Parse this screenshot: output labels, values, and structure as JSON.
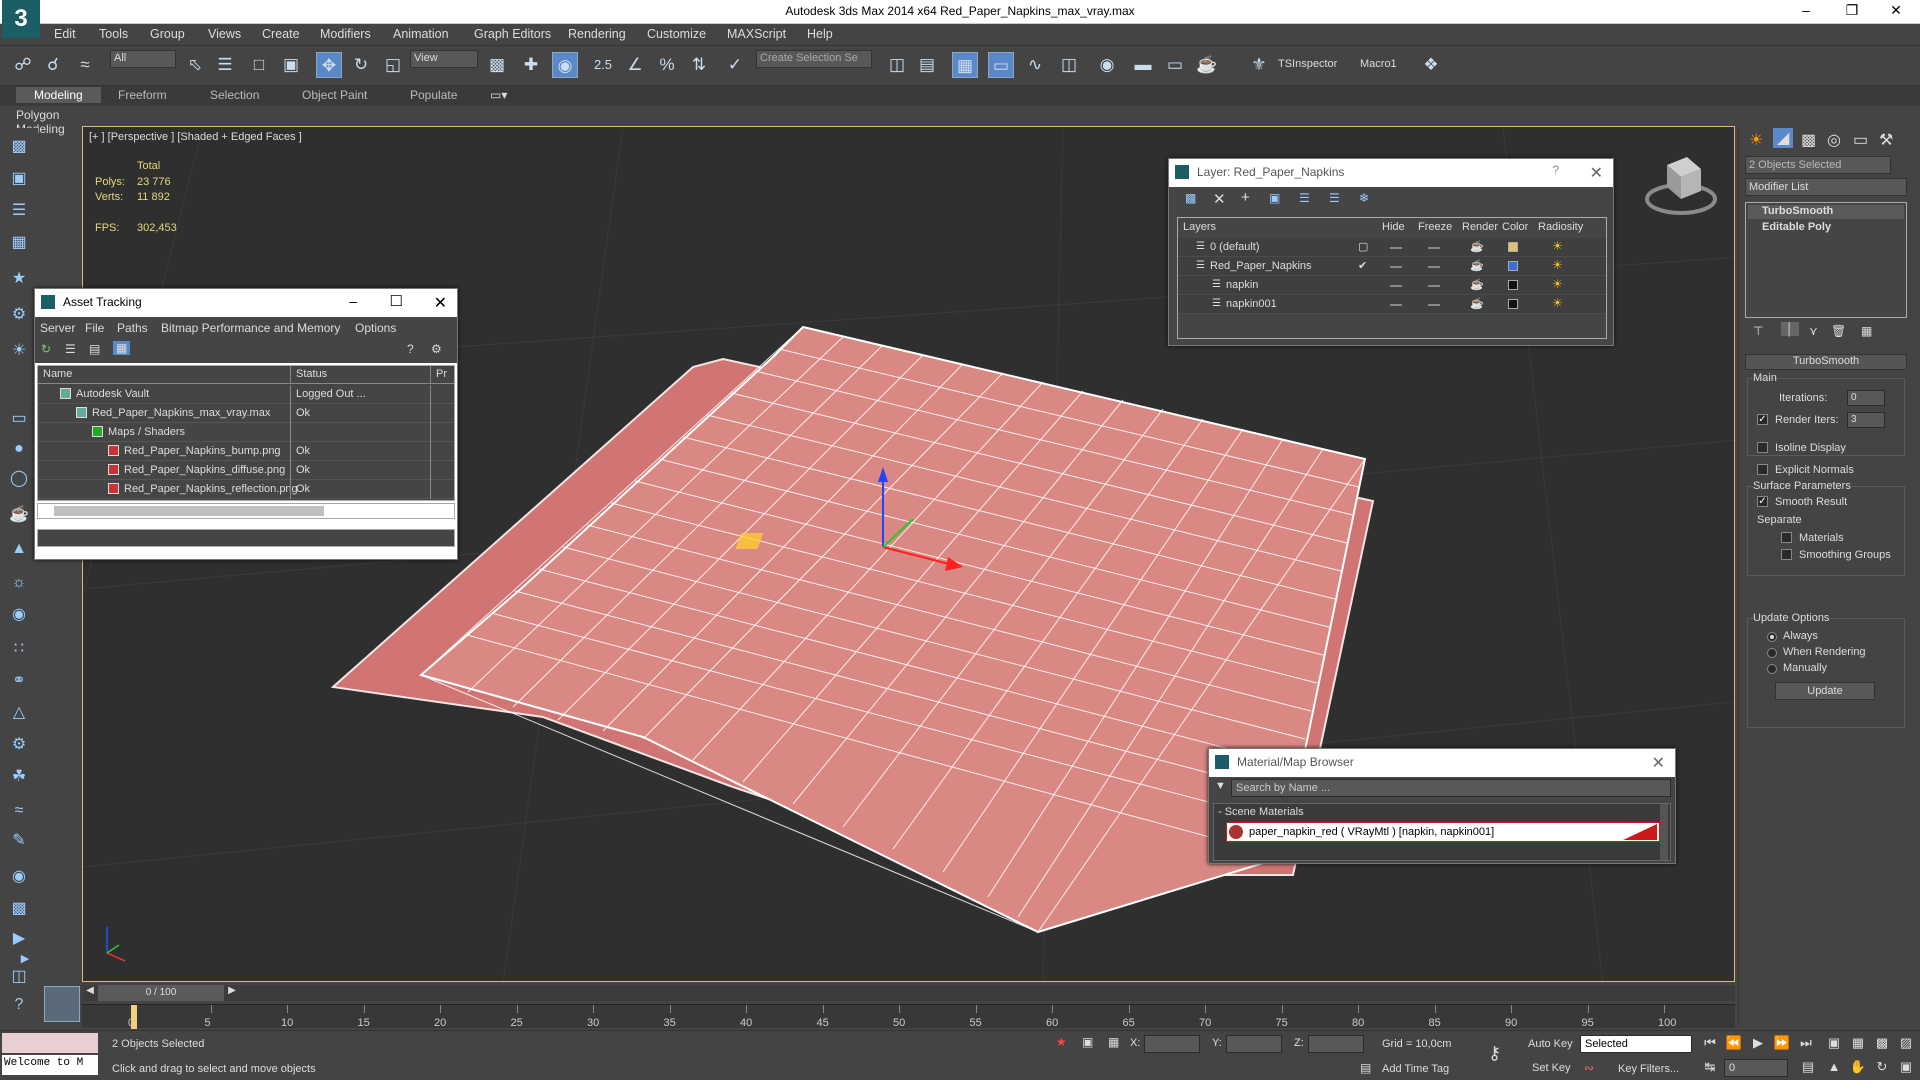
{
  "app": {
    "title": "Autodesk 3ds Max  2014 x64     Red_Paper_Napkins_max_vray.max",
    "logo": "3"
  },
  "menu": [
    "Edit",
    "Tools",
    "Group",
    "Views",
    "Create",
    "Modifiers",
    "Animation",
    "Graph Editors",
    "Rendering",
    "Customize",
    "MAXScript",
    "Help"
  ],
  "toolbar": {
    "filter_value": "All",
    "ref_coord_value": "View",
    "selection_set_placeholder": "Create Selection Se",
    "snap_label": "2.5",
    "tsinspector": "TSInspector",
    "macro": "Macro1"
  },
  "ribbon": {
    "tabs": [
      "Modeling",
      "Freeform",
      "Selection",
      "Object Paint",
      "Populate"
    ],
    "active": "Modeling",
    "sub_label": "Polygon Modeling"
  },
  "viewport": {
    "label": "[+ ] [Perspective ] [Shaded + Edged Faces ]",
    "stats": {
      "total_label": "Total",
      "polys_label": "Polys:",
      "polys_value": "23 776",
      "verts_label": "Verts:",
      "verts_value": "11 892",
      "fps_label": "FPS:",
      "fps_value": "302,453"
    }
  },
  "asset_tracking": {
    "title": "Asset Tracking",
    "menu": [
      "Server",
      "File",
      "Paths",
      "Bitmap Performance and Memory",
      "Options"
    ],
    "columns": [
      "Name",
      "Status",
      "Pr"
    ],
    "rows": [
      {
        "name": "Autodesk Vault",
        "status": "Logged Out ...",
        "indent": 0,
        "icon": "vault-icon"
      },
      {
        "name": "Red_Paper_Napkins_max_vray.max",
        "status": "Ok",
        "indent": 1,
        "icon": "max-file-icon"
      },
      {
        "name": "Maps / Shaders",
        "status": "",
        "indent": 2,
        "icon": "maps-icon"
      },
      {
        "name": "Red_Paper_Napkins_bump.png",
        "status": "Ok",
        "indent": 3,
        "icon": "bitmap-icon"
      },
      {
        "name": "Red_Paper_Napkins_diffuse.png",
        "status": "Ok",
        "indent": 3,
        "icon": "bitmap-icon"
      },
      {
        "name": "Red_Paper_Napkins_reflection.png",
        "status": "Ok",
        "indent": 3,
        "icon": "bitmap-icon"
      }
    ]
  },
  "layer_window": {
    "title": "Layer: Red_Paper_Napkins",
    "help": "?",
    "columns": [
      "Layers",
      "Hide",
      "Freeze",
      "Render",
      "Color",
      "Radiosity"
    ],
    "rows": [
      {
        "name": "0 (default)",
        "indent": 0,
        "color": "#e8c070",
        "current": "▢"
      },
      {
        "name": "Red_Paper_Napkins",
        "indent": 0,
        "color": "#3a6fd8",
        "current": "✔"
      },
      {
        "name": "napkin",
        "indent": 1,
        "color": "#111111",
        "current": ""
      },
      {
        "name": "napkin001",
        "indent": 1,
        "color": "#111111",
        "current": ""
      }
    ]
  },
  "material_browser": {
    "title": "Material/Map Browser",
    "search_placeholder": "Search by Name ...",
    "section": "- Scene Materials",
    "material": "paper_napkin_red  ( VRayMtl ) [napkin, napkin001]",
    "material_color": "#cc1a1a"
  },
  "command_panel": {
    "selection": "2 Objects Selected",
    "modifier_list": "Modifier List",
    "stack": [
      "TurboSmooth",
      "Editable Poly"
    ],
    "rollout_title": "TurboSmooth",
    "main_label": "Main",
    "iterations_label": "Iterations:",
    "iterations_value": "0",
    "render_iters_label": "Render Iters:",
    "render_iters_value": "3",
    "isoline": "Isoline Display",
    "explicit_normals": "Explicit Normals",
    "surface_params": "Surface Parameters",
    "smooth_result": "Smooth Result",
    "separate": "Separate",
    "materials": "Materials",
    "smoothing_groups": "Smoothing Groups",
    "update_options": "Update Options",
    "always": "Always",
    "when_rendering": "When Rendering",
    "manually": "Manually",
    "update_button": "Update"
  },
  "timeline": {
    "slider_label": "0 / 100",
    "ticks": [
      "0",
      "5",
      "10",
      "15",
      "20",
      "25",
      "30",
      "35",
      "40",
      "45",
      "50",
      "55",
      "60",
      "65",
      "70",
      "75",
      "80",
      "85",
      "90",
      "95",
      "100"
    ]
  },
  "status": {
    "maxscript": "Welcome to M",
    "selected": "2 Objects Selected",
    "prompt": "Click and drag to select and move objects",
    "x_label": "X:",
    "y_label": "Y:",
    "z_label": "Z:",
    "grid": "Grid = 10,0cm",
    "add_time_tag": "Add Time Tag",
    "auto_key": "Auto Key",
    "set_key": "Set Key",
    "selected_dd": "Selected",
    "key_filters": "Key Filters...",
    "frame_value": "0"
  },
  "colors": {
    "accent": "#5b88c9",
    "napkin": "#d77a78",
    "viewport_border": "#dcbd73"
  }
}
